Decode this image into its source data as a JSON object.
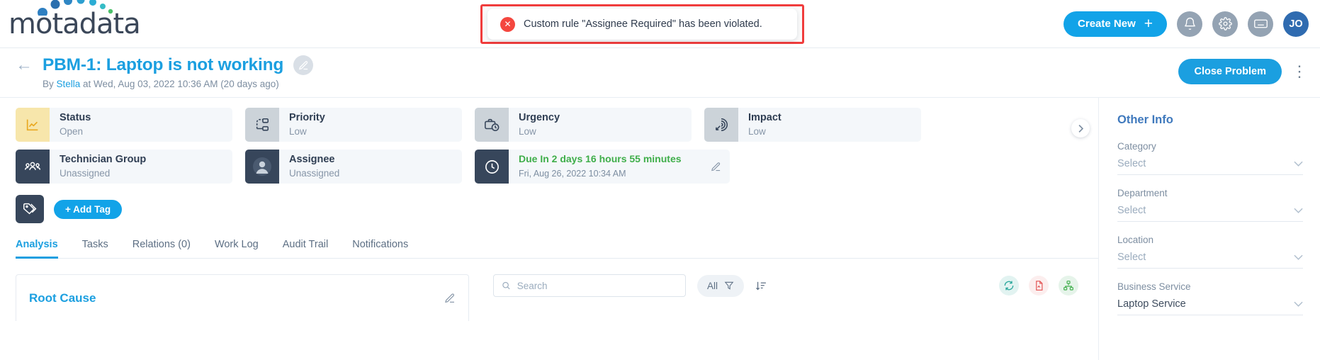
{
  "brand": {
    "name": "motadata",
    "accent": "#12a3e8"
  },
  "toast": {
    "message": "Custom rule \"Assignee Required\" has been violated.",
    "icon": "error-circle-icon",
    "highlight_color": "#f03c3c"
  },
  "topbar": {
    "create_label": "Create New",
    "plus": "+",
    "icons": [
      "bell-icon",
      "gear-icon",
      "keyboard-icon"
    ],
    "avatar_initials": "JO"
  },
  "title": {
    "back": "←",
    "text": "PBM-1: Laptop is not working",
    "byline_prefix": "By ",
    "byline_user": "Stella",
    "byline_rest": " at Wed, Aug 03, 2022 10:36 AM (20 days ago)",
    "close_label": "Close Problem",
    "kebab": "⋮"
  },
  "tiles": [
    {
      "label": "Status",
      "value": "Open",
      "icon": "chart-line-icon",
      "icon_style": "ico-yellow"
    },
    {
      "label": "Priority",
      "value": "Low",
      "icon": "priority-flow-icon",
      "icon_style": "ico-grey"
    },
    {
      "label": "Urgency",
      "value": "Low",
      "icon": "briefcase-clock-icon",
      "icon_style": "ico-grey"
    },
    {
      "label": "Impact",
      "value": "Low",
      "icon": "impact-target-icon",
      "icon_style": "ico-grey"
    },
    {
      "label": "Technician Group",
      "value": "Unassigned",
      "icon": "group-icon",
      "icon_style": "ico-dark"
    },
    {
      "label": "Assignee",
      "value": "Unassigned",
      "icon": "user-avatar-icon",
      "icon_style": "ico-dark"
    }
  ],
  "due": {
    "label": "Due In 2 days 16 hours 55 minutes",
    "sub": "Fri, Aug 26, 2022 10:34 AM",
    "icon": "clock-icon",
    "color": "#3fae4a"
  },
  "tag": {
    "icon": "tag-icon",
    "add_label": "+ Add Tag"
  },
  "tabs": [
    {
      "label": "Analysis",
      "active": true
    },
    {
      "label": "Tasks",
      "active": false
    },
    {
      "label": "Relations (0)",
      "active": false
    },
    {
      "label": "Work Log",
      "active": false
    },
    {
      "label": "Audit Trail",
      "active": false
    },
    {
      "label": "Notifications",
      "active": false
    }
  ],
  "root_cause": {
    "title": "Root Cause",
    "edit_icon": "pencil-icon"
  },
  "list_toolbar": {
    "search_placeholder": "Search",
    "search_value": "",
    "filter_label": "All",
    "filter_icon": "funnel-icon",
    "sort_icon": "sort-desc-icon",
    "actions": [
      "refresh-icon",
      "pdf-icon",
      "relations-icon"
    ]
  },
  "other_info": {
    "title": "Other Info",
    "fields": [
      {
        "label": "Category",
        "value": "Select",
        "filled": false
      },
      {
        "label": "Department",
        "value": "Select",
        "filled": false
      },
      {
        "label": "Location",
        "value": "Select",
        "filled": false
      },
      {
        "label": "Business Service",
        "value": "Laptop Service",
        "filled": true
      }
    ]
  }
}
